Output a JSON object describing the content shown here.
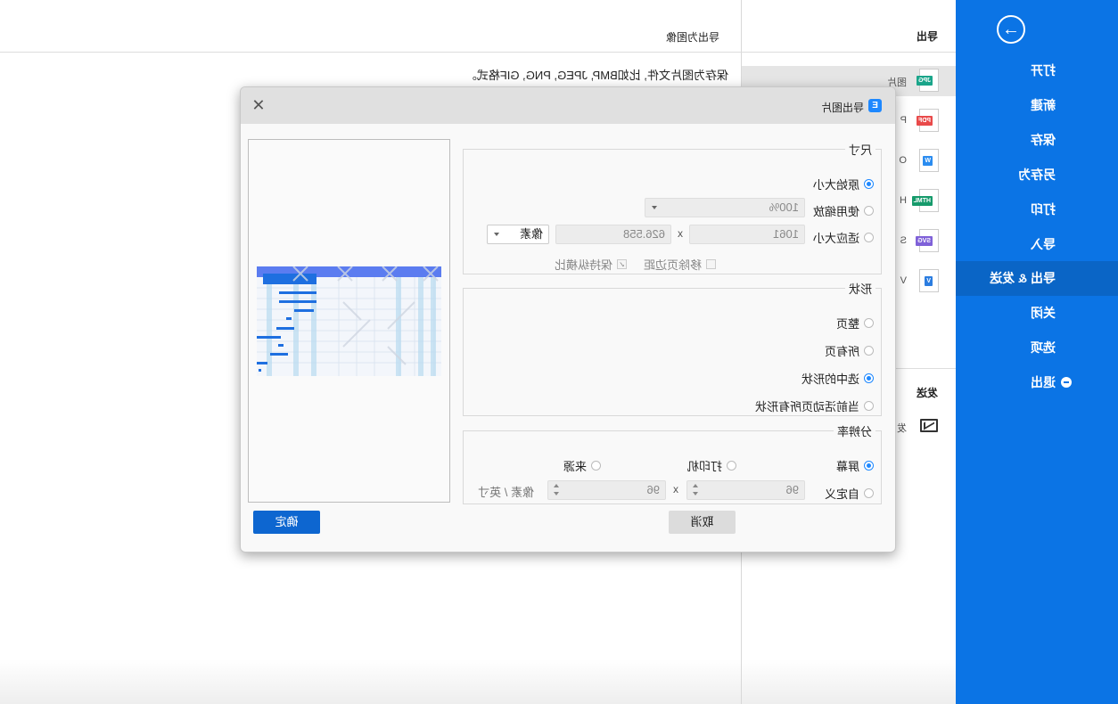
{
  "sidebar": {
    "back_icon": "arrow-right-circle-icon",
    "items": [
      {
        "label": "打开"
      },
      {
        "label": "新建"
      },
      {
        "label": "保存"
      },
      {
        "label": "另存为"
      },
      {
        "label": "打印"
      },
      {
        "label": "导入"
      },
      {
        "label": "导出 & 发送",
        "active": true
      },
      {
        "label": "关闭"
      },
      {
        "label": "选项"
      },
      {
        "label": "退出",
        "icon": "exit-icon"
      }
    ]
  },
  "export_panel": {
    "title": "导出",
    "items": [
      {
        "badge": "JPG",
        "color": "#1aa58a",
        "label": "图片",
        "active": true
      },
      {
        "badge": "PDF",
        "color": "#e94a4a",
        "label": "P"
      },
      {
        "badge": "W",
        "color": "#2b8cf0",
        "label": "O"
      },
      {
        "badge": "HTML",
        "color": "#169a6b",
        "label": "H"
      },
      {
        "badge": "SVG",
        "color": "#7f61d8",
        "label": "S"
      },
      {
        "badge": "V",
        "color": "#2b7de0",
        "label": "V"
      }
    ],
    "send_title": "发送",
    "send_item_label": "发"
  },
  "content": {
    "title": "导出为图像",
    "description": "保存为图片文件, 比如BMP, JPEG, PNG, GIF格式。"
  },
  "dialog": {
    "title": "导出图片",
    "logo": "E",
    "size_group": {
      "legend": "尺寸",
      "options": [
        "原始大小",
        "使用缩放",
        "适应大小"
      ],
      "selected": "原始大小",
      "zoom_value": "100%",
      "width_value": "1061",
      "height_value": "626.558",
      "unit": "像素",
      "x": "x",
      "remove_margin": "移除页边距",
      "remove_margin_checked": false,
      "keep_ratio": "保持纵横比",
      "keep_ratio_checked": true
    },
    "shape_group": {
      "legend": "形状",
      "options": [
        "整页",
        "所有页",
        "选中的形状",
        "当前活动页所有形状"
      ],
      "selected": "选中的形状"
    },
    "resolution_group": {
      "legend": "分辨率",
      "options": [
        "屏幕",
        "打印机",
        "来源",
        "自定义"
      ],
      "selected": "屏幕",
      "dpi_x": "96",
      "dpi_y": "96",
      "x": "x",
      "unit": "像素 / 英寸"
    },
    "ok_label": "确定",
    "cancel_label": "取消"
  },
  "colors": {
    "accent": "#0b74e5",
    "accent_active": "#0a65c6",
    "ok_button": "#0d66d0"
  }
}
